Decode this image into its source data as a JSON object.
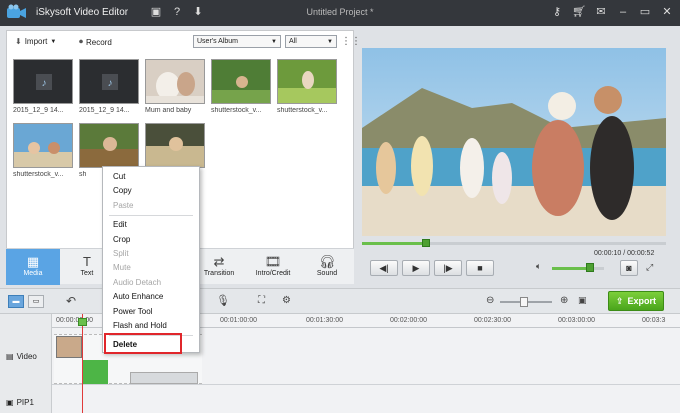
{
  "titlebar": {
    "app_name": "iSkysoft Video Editor",
    "project_title": "Untitled Project *",
    "icons": [
      "save-icon",
      "help-icon",
      "download-icon",
      "key-icon",
      "cart-icon",
      "chat-icon",
      "minimize-icon",
      "restore-icon",
      "close-icon"
    ]
  },
  "library": {
    "import_label": "Import",
    "record_label": "Record",
    "album_select": "User's Album",
    "filter_select": "All",
    "items": [
      {
        "label": "2015_12_9 14..."
      },
      {
        "label": "2015_12_9 14..."
      },
      {
        "label": "Mum and baby"
      },
      {
        "label": "shutterstock_v..."
      },
      {
        "label": "shutterstock_v..."
      },
      {
        "label": "shutterstock_v..."
      },
      {
        "label": "sh"
      },
      {
        "label": ""
      }
    ]
  },
  "tabs": [
    {
      "label": "Media"
    },
    {
      "label": "Text"
    },
    {
      "label": "Transition"
    },
    {
      "label": "Intro/Credit"
    },
    {
      "label": "Sound"
    }
  ],
  "preview": {
    "time_display": "00:00:10 / 00:00:52",
    "progress": 0.2
  },
  "context_menu": {
    "items": [
      {
        "label": "Cut",
        "enabled": true
      },
      {
        "label": "Copy",
        "enabled": true
      },
      {
        "label": "Paste",
        "enabled": false
      },
      {
        "label": "Edit",
        "enabled": true
      },
      {
        "label": "Crop",
        "enabled": true
      },
      {
        "label": "Split",
        "enabled": false
      },
      {
        "label": "Mute",
        "enabled": false
      },
      {
        "label": "Audio Detach",
        "enabled": false
      },
      {
        "label": "Auto Enhance",
        "enabled": true
      },
      {
        "label": "Power Tool",
        "enabled": true
      },
      {
        "label": "Flash and Hold",
        "enabled": true
      },
      {
        "label": "Delete",
        "enabled": true
      }
    ]
  },
  "timeline": {
    "export_label": "Export",
    "ruler": [
      "00:00:00:00",
      "00:01:00:00",
      "00:01:30:00",
      "00:02:00:00",
      "00:02:30:00",
      "00:03:00:00",
      "00:03:3"
    ],
    "tracks": [
      {
        "label": "Video"
      },
      {
        "label": "PIP1"
      }
    ]
  },
  "colors": {
    "accent": "#5aa4e4",
    "export_green": "#4aa51c",
    "highlight_red": "#e0262b",
    "titlebar": "#34373c"
  }
}
